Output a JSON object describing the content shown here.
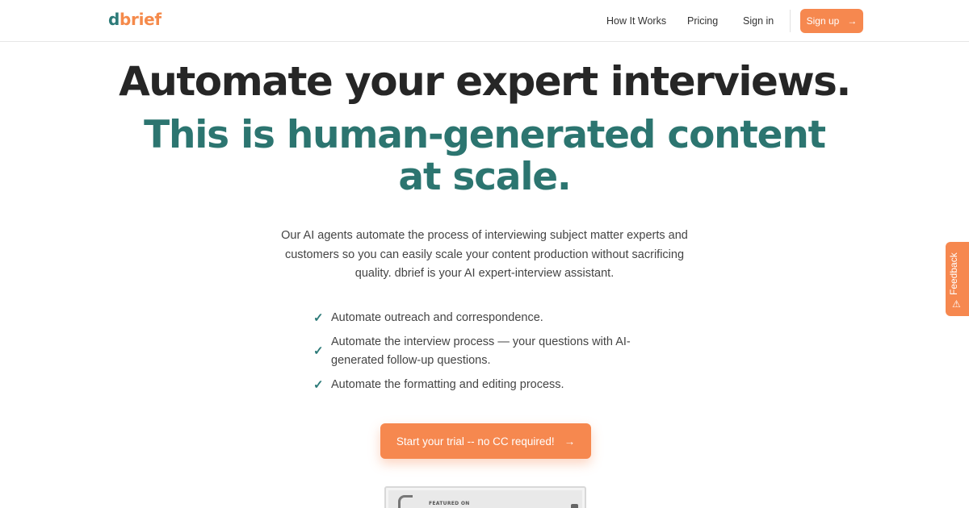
{
  "header": {
    "logo_prefix": "d",
    "logo_rest": "brief",
    "nav": {
      "how_it_works": "How It Works",
      "pricing": "Pricing",
      "sign_in": "Sign in"
    },
    "signup_label": "Sign up",
    "signup_icon": "arrow-right-icon"
  },
  "hero": {
    "headline": "Automate your expert interviews.",
    "subheadline": "This is human-generated content at scale.",
    "lead": "Our AI agents automate the process of interviewing subject matter experts and customers so you can easily scale your content production without sacrificing quality. dbrief is your AI expert-interview assistant."
  },
  "features": [
    {
      "text": "Automate outreach and correspondence.",
      "icon": "check-icon"
    },
    {
      "text": "Automate the interview process — your questions with AI-generated follow-up questions.",
      "icon": "check-icon"
    },
    {
      "text": "Automate the formatting and editing process.",
      "icon": "check-icon"
    }
  ],
  "cta": {
    "label": "Start your trial -- no CC required!",
    "icon": "arrow-right-icon"
  },
  "featured": {
    "label": "FEATURED ON"
  },
  "feedback": {
    "label": "Feedback",
    "icon": "warning-icon"
  },
  "colors": {
    "accent_orange": "#f6884f",
    "brand_teal": "#2c7570",
    "text_dark": "#262626"
  }
}
